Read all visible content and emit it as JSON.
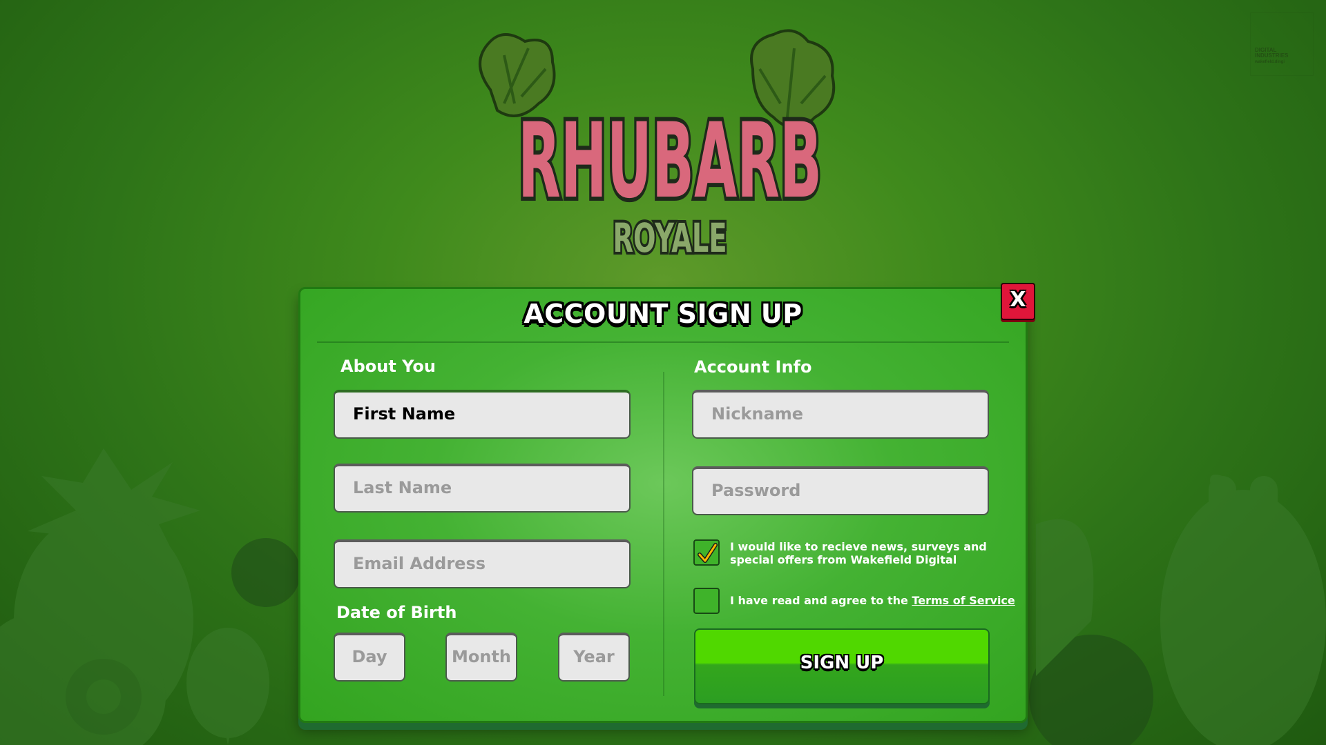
{
  "corner_logo": {
    "line1": "DIGITAL",
    "line2": "INDUSTRIES",
    "line3": "wakefield.dingi"
  },
  "logo": {
    "word1": "RHUBARB",
    "word2": "ROYALE"
  },
  "panel": {
    "title": "ACCOUNT SIGN UP",
    "close_label": "X",
    "about": {
      "title": "About You",
      "first_name": "First Name",
      "last_name": "Last Name",
      "email": "Email Address",
      "dob_title": "Date of Birth",
      "day": "Day",
      "month": "Month",
      "year": "Year"
    },
    "account": {
      "title": "Account Info",
      "nickname": "Nickname",
      "password": "Password",
      "news_opt_in": {
        "checked": true,
        "line1": "I would like to recieve news, surveys and",
        "line2": "special offers from Wakefield Digital"
      },
      "terms": {
        "checked": false,
        "text": "I have read and agree to the ",
        "link": "Terms of Service"
      },
      "signup_label": "SIGN UP"
    }
  },
  "colors": {
    "background": "#3f8a1c",
    "panel": "#44b233",
    "close_button": "#e0163a",
    "signup_button": "#50d800",
    "logo_pink": "#d9687c"
  }
}
